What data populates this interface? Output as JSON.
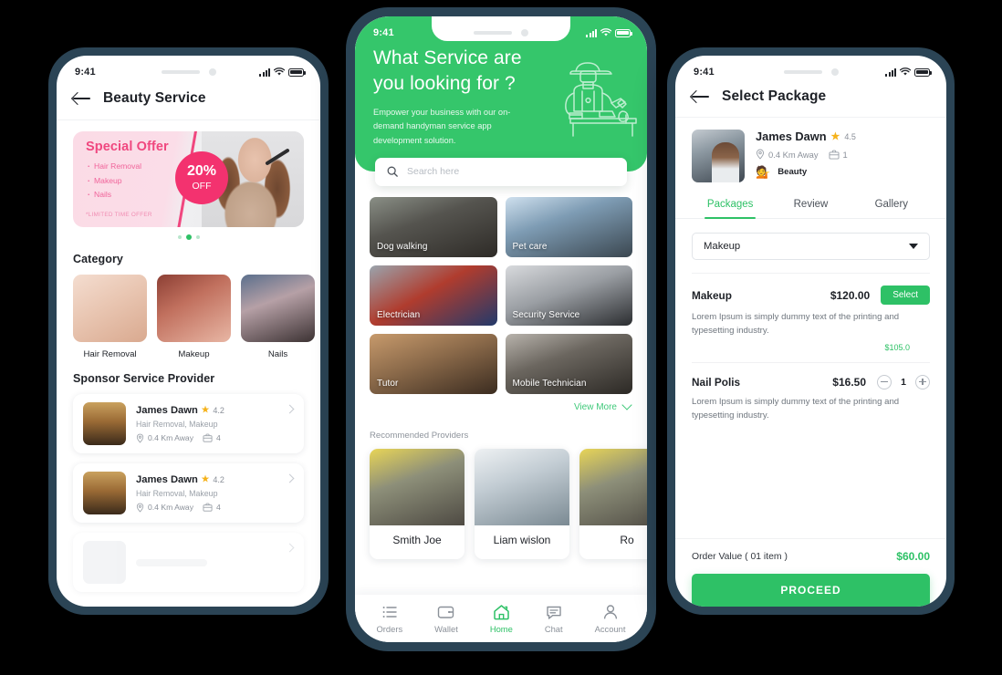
{
  "phone_left": {
    "status": {
      "time": "9:41"
    },
    "header": {
      "title": "Beauty Service",
      "back_icon": "arrow-left-icon"
    },
    "offer": {
      "title": "Special Offer",
      "items": [
        "Hair Removal",
        "Makeup",
        "Nails"
      ],
      "badge_percent": "20%",
      "badge_off": "OFF",
      "fine_print": "*LIMITED TIME OFFER",
      "accent_color": "#f3326f"
    },
    "category": {
      "title": "Category",
      "items": [
        {
          "label": "Hair Removal"
        },
        {
          "label": "Makeup"
        },
        {
          "label": "Nails"
        }
      ]
    },
    "sponsor": {
      "title": "Sponsor Service Provider",
      "providers": [
        {
          "name": "James Dawn",
          "rating": "4.2",
          "services": "Hair Removal, Makeup",
          "distance": "0.4 Km Away",
          "jobs": "4"
        },
        {
          "name": "James Dawn",
          "rating": "4.2",
          "services": "Hair Removal, Makeup",
          "distance": "0.4 Km Away",
          "jobs": "4"
        }
      ]
    }
  },
  "phone_mid": {
    "status": {
      "time": "9:41"
    },
    "hero": {
      "heading": "What Service are you looking for ?",
      "subheading": "Empower your business with our on-demand handyman service app development solution.",
      "bg_color": "#35c66b"
    },
    "search": {
      "placeholder": "Search here",
      "icon": "search-icon"
    },
    "services": [
      {
        "label": "Dog walking"
      },
      {
        "label": "Pet care"
      },
      {
        "label": "Electrician"
      },
      {
        "label": "Security Service"
      },
      {
        "label": "Tutor"
      },
      {
        "label": "Mobile Technician"
      }
    ],
    "view_more": {
      "label": "View More",
      "icon": "chevron-down-icon"
    },
    "recommended": {
      "title": "Recommended Providers",
      "providers": [
        {
          "name": "Smith Joe"
        },
        {
          "name": "Liam wislon"
        },
        {
          "name": "Ro"
        }
      ]
    },
    "tabbar": {
      "items": [
        {
          "label": "Orders",
          "icon": "list-icon",
          "active": false
        },
        {
          "label": "Wallet",
          "icon": "wallet-icon",
          "active": false
        },
        {
          "label": "Home",
          "icon": "home-icon",
          "active": true
        },
        {
          "label": "Chat",
          "icon": "chat-icon",
          "active": false
        },
        {
          "label": "Account",
          "icon": "person-icon",
          "active": false
        }
      ],
      "active_color": "#2ec166"
    }
  },
  "phone_right": {
    "status": {
      "time": "9:41"
    },
    "header": {
      "title": "Select Package",
      "back_icon": "arrow-left-icon"
    },
    "profile": {
      "name": "James Dawn",
      "rating": "4.5",
      "distance": "0.4 Km Away",
      "jobs": "1",
      "category": "Beauty",
      "category_emoji": "💁"
    },
    "tabs": [
      {
        "label": "Packages",
        "active": true
      },
      {
        "label": "Review",
        "active": false
      },
      {
        "label": "Gallery",
        "active": false
      }
    ],
    "dropdown": {
      "value": "Makeup",
      "icon": "caret-down-icon"
    },
    "packages": [
      {
        "name": "Makeup",
        "price": "$120.00",
        "action_label": "Select",
        "description": "Lorem Ipsum is simply dummy text of the printing and typesetting industry.",
        "alt_price": "$105.0",
        "has_stepper": false
      },
      {
        "name": "Nail Polis",
        "price": "$16.50",
        "description": "Lorem Ipsum is simply dummy text of the printing and typesetting industry.",
        "quantity": "1",
        "has_stepper": true
      }
    ],
    "footer": {
      "order_label": "Order Value ( 01 item )",
      "order_value": "$60.00",
      "proceed_label": "PROCEED",
      "accent_color": "#2ec166"
    }
  }
}
